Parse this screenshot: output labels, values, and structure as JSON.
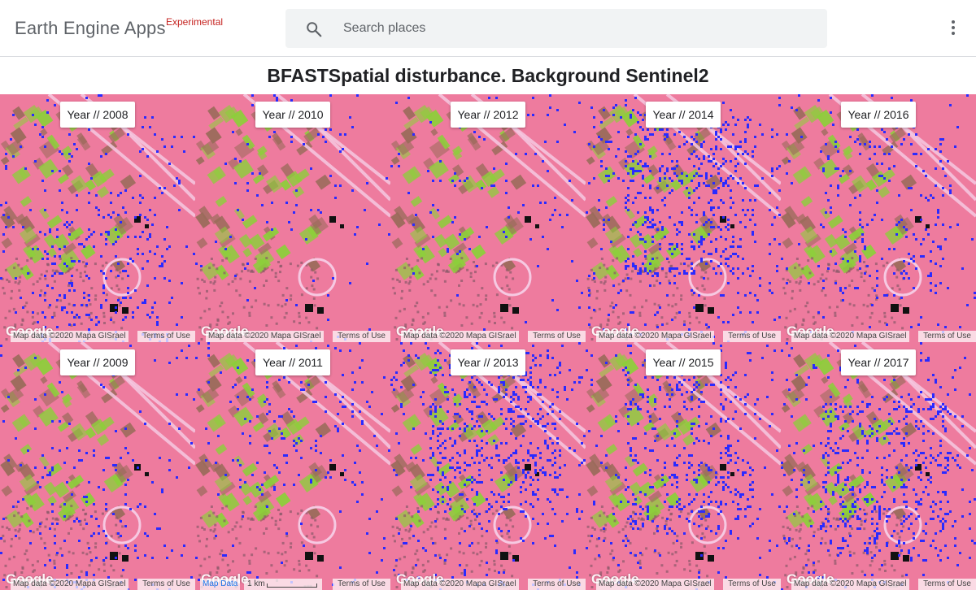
{
  "header": {
    "brand": "Earth Engine Apps",
    "brand_tag": "Experimental",
    "search_placeholder": "Search places"
  },
  "page_title": "BFASTSpatial disturbance. Background Sentinel2",
  "attribution": {
    "google": "Google",
    "map_data": "Map data ©2020 Mapa GISrael",
    "terms": "Terms of Use",
    "map_data_link": "Map Data",
    "scale": "1 km"
  },
  "tiles": [
    {
      "label": "Year // 2008",
      "seed": 2008,
      "density": 0.16
    },
    {
      "label": "Year // 2010",
      "seed": 2010,
      "density": 0.05
    },
    {
      "label": "Year // 2012",
      "seed": 2012,
      "density": 0.05
    },
    {
      "label": "Year // 2014",
      "seed": 2014,
      "density": 0.3
    },
    {
      "label": "Year // 2016",
      "seed": 2016,
      "density": 0.12
    },
    {
      "label": "Year // 2009",
      "seed": 2009,
      "density": 0.1
    },
    {
      "label": "Year // 2011",
      "seed": 2011,
      "density": 0.1
    },
    {
      "label": "Year // 2013",
      "seed": 2013,
      "density": 0.32
    },
    {
      "label": "Year // 2015",
      "seed": 2015,
      "density": 0.22
    },
    {
      "label": "Year // 2017",
      "seed": 2017,
      "density": 0.28
    }
  ],
  "colors": {
    "background": "#ee7b9e",
    "field_green": "#8ccf3a",
    "field_brown": "#9a6b5a",
    "disturbance": "#2a2aff",
    "road": "#f6c9e2"
  }
}
